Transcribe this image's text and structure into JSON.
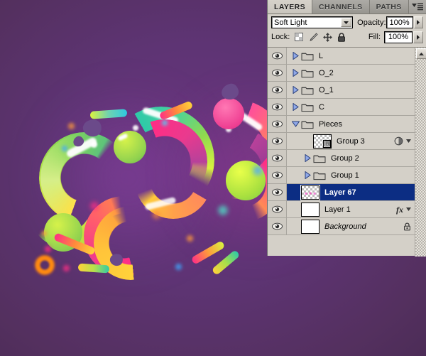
{
  "app": {
    "window_title": "Adobe Photoshop — Layers panel over colorful artwork"
  },
  "artwork": {
    "name": "colorful-glossy-rings-composition",
    "background_gradient": [
      "#5c3b72",
      "#4e2d5e"
    ],
    "accent_colors": [
      "#8ed14f",
      "#f6ec3c",
      "#ff2e85",
      "#2ec9a8",
      "#ff8a3c",
      "#d4ff2e",
      "#ff6a00"
    ]
  },
  "panel": {
    "tabs": [
      {
        "label": "LAYERS",
        "active": true,
        "name": "tab-layers"
      },
      {
        "label": "CHANNELS",
        "active": false,
        "name": "tab-channels"
      },
      {
        "label": "PATHS",
        "active": false,
        "name": "tab-paths"
      }
    ],
    "menu_icon": "panel-menu-icon",
    "blend_mode": {
      "label_icon": "chevron-down-icon",
      "value": "Soft Light"
    },
    "opacity": {
      "label": "Opacity:",
      "value": "100%"
    },
    "fill": {
      "label": "Fill:",
      "value": "100%"
    },
    "lock": {
      "label": "Lock:",
      "icons": [
        {
          "name": "lock-transparent-pixels-icon",
          "title": "Lock transparent pixels"
        },
        {
          "name": "lock-image-pixels-icon",
          "title": "Lock image pixels"
        },
        {
          "name": "lock-position-icon",
          "title": "Lock position"
        },
        {
          "name": "lock-all-icon",
          "title": "Lock all"
        }
      ]
    },
    "scrollbar": {
      "up_arrow_icon": "scroll-up-arrow-icon"
    },
    "layers": [
      {
        "name": "L",
        "kind": "group",
        "indent": 0,
        "visible": true,
        "expanded": false,
        "selected": false,
        "italic": false,
        "thumb": "folder",
        "right_icons": []
      },
      {
        "name": "O_2",
        "kind": "group",
        "indent": 0,
        "visible": true,
        "expanded": false,
        "selected": false,
        "italic": false,
        "thumb": "folder",
        "right_icons": []
      },
      {
        "name": "O_1",
        "kind": "group",
        "indent": 0,
        "visible": true,
        "expanded": false,
        "selected": false,
        "italic": false,
        "thumb": "folder",
        "right_icons": []
      },
      {
        "name": "C",
        "kind": "group",
        "indent": 0,
        "visible": true,
        "expanded": false,
        "selected": false,
        "italic": false,
        "thumb": "folder",
        "right_icons": []
      },
      {
        "name": "Pieces",
        "kind": "group",
        "indent": 0,
        "visible": true,
        "expanded": true,
        "selected": false,
        "italic": false,
        "thumb": "folder",
        "right_icons": []
      },
      {
        "name": "Group 3",
        "kind": "smart-object",
        "indent": 1,
        "visible": true,
        "expanded": null,
        "selected": false,
        "italic": false,
        "thumb": "checker-smart-object",
        "right_icons": [
          "adjustment-icon",
          "chevron-down-icon"
        ]
      },
      {
        "name": "Group 2",
        "kind": "group",
        "indent": 1,
        "visible": true,
        "expanded": false,
        "selected": false,
        "italic": false,
        "thumb": "folder",
        "right_icons": []
      },
      {
        "name": "Group 1",
        "kind": "group",
        "indent": 1,
        "visible": true,
        "expanded": false,
        "selected": false,
        "italic": false,
        "thumb": "folder",
        "right_icons": []
      },
      {
        "name": "Layer 67",
        "kind": "pixel",
        "indent": 0,
        "visible": true,
        "expanded": null,
        "selected": true,
        "italic": false,
        "thumb": "checker-pink-dots",
        "right_icons": []
      },
      {
        "name": "Layer 1",
        "kind": "pixel",
        "indent": 0,
        "visible": true,
        "expanded": null,
        "selected": false,
        "italic": false,
        "thumb": "white",
        "right_icons": [
          "fx-icon",
          "chevron-down-icon"
        ]
      },
      {
        "name": "Background",
        "kind": "background",
        "indent": 0,
        "visible": true,
        "expanded": null,
        "selected": false,
        "italic": true,
        "thumb": "white",
        "right_icons": [
          "lock-icon"
        ]
      }
    ]
  }
}
